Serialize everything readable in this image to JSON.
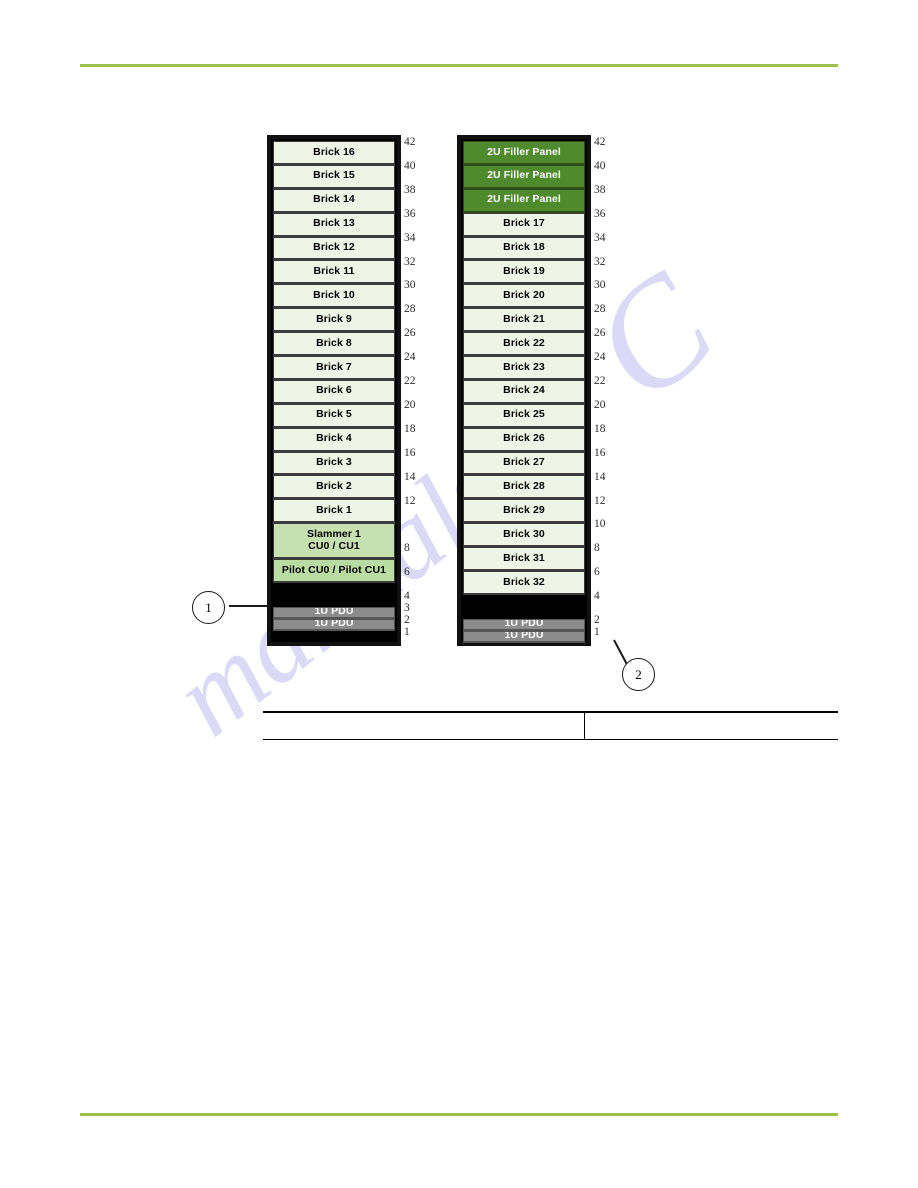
{
  "page": {
    "rule_color": "#9cc14a",
    "watermark_lines": [
      "manualsli",
      "C"
    ]
  },
  "diagram": {
    "racks": [
      {
        "id": "rack-left",
        "name": "left-rack",
        "units": [
          {
            "label": "Brick 16",
            "type": "brick",
            "u": 2
          },
          {
            "label": "Brick 15",
            "type": "brick",
            "u": 2
          },
          {
            "label": "Brick 14",
            "type": "brick",
            "u": 2
          },
          {
            "label": "Brick 13",
            "type": "brick",
            "u": 2
          },
          {
            "label": "Brick 12",
            "type": "brick",
            "u": 2
          },
          {
            "label": "Brick 11",
            "type": "brick",
            "u": 2
          },
          {
            "label": "Brick 10",
            "type": "brick",
            "u": 2
          },
          {
            "label": "Brick 9",
            "type": "brick",
            "u": 2
          },
          {
            "label": "Brick 8",
            "type": "brick",
            "u": 2
          },
          {
            "label": "Brick 7",
            "type": "brick",
            "u": 2
          },
          {
            "label": "Brick 6",
            "type": "brick",
            "u": 2
          },
          {
            "label": "Brick 5",
            "type": "brick",
            "u": 2
          },
          {
            "label": "Brick 4",
            "type": "brick",
            "u": 2
          },
          {
            "label": "Brick 3",
            "type": "brick",
            "u": 2
          },
          {
            "label": "Brick 2",
            "type": "brick",
            "u": 2
          },
          {
            "label": "Brick 1",
            "type": "brick",
            "u": 2
          },
          {
            "label": "Slammer 1\nCU0 / CU1",
            "type": "slammer",
            "u": 3
          },
          {
            "label": "Pilot CU0 / Pilot CU1",
            "type": "pilot",
            "u": 2
          },
          {
            "label": "",
            "type": "blank",
            "u": 2
          },
          {
            "label": "1U PDU",
            "type": "pdu",
            "u": 1
          },
          {
            "label": "1U PDU",
            "type": "pdu",
            "u": 1
          }
        ],
        "ruler": [
          "42",
          "40",
          "38",
          "36",
          "34",
          "32",
          "30",
          "28",
          "26",
          "24",
          "22",
          "20",
          "18",
          "16",
          "14",
          "12",
          "8",
          "6",
          "4",
          "3",
          "2",
          "1"
        ]
      },
      {
        "id": "rack-right",
        "name": "right-rack",
        "units": [
          {
            "label": "2U Filler Panel",
            "type": "filler",
            "u": 2
          },
          {
            "label": "2U Filler Panel",
            "type": "filler",
            "u": 2
          },
          {
            "label": "2U Filler Panel",
            "type": "filler",
            "u": 2
          },
          {
            "label": "Brick 17",
            "type": "brick",
            "u": 2
          },
          {
            "label": "Brick 18",
            "type": "brick",
            "u": 2
          },
          {
            "label": "Brick 19",
            "type": "brick",
            "u": 2
          },
          {
            "label": "Brick 20",
            "type": "brick",
            "u": 2
          },
          {
            "label": "Brick 21",
            "type": "brick",
            "u": 2
          },
          {
            "label": "Brick 22",
            "type": "brick",
            "u": 2
          },
          {
            "label": "Brick 23",
            "type": "brick",
            "u": 2
          },
          {
            "label": "Brick 24",
            "type": "brick",
            "u": 2
          },
          {
            "label": "Brick 25",
            "type": "brick",
            "u": 2
          },
          {
            "label": "Brick 26",
            "type": "brick",
            "u": 2
          },
          {
            "label": "Brick 27",
            "type": "brick",
            "u": 2
          },
          {
            "label": "Brick 28",
            "type": "brick",
            "u": 2
          },
          {
            "label": "Brick 29",
            "type": "brick",
            "u": 2
          },
          {
            "label": "Brick 30",
            "type": "brick",
            "u": 2
          },
          {
            "label": "Brick 31",
            "type": "brick",
            "u": 2
          },
          {
            "label": "Brick 32",
            "type": "brick",
            "u": 2
          },
          {
            "label": "",
            "type": "blank",
            "u": 2
          },
          {
            "label": "1U PDU",
            "type": "pdu",
            "u": 1
          },
          {
            "label": "1U PDU",
            "type": "pdu",
            "u": 1
          }
        ],
        "ruler": [
          "42",
          "40",
          "38",
          "36",
          "34",
          "32",
          "30",
          "28",
          "26",
          "24",
          "22",
          "20",
          "18",
          "16",
          "14",
          "12",
          "10",
          "8",
          "6",
          "4",
          "2",
          "1"
        ]
      }
    ],
    "callouts": [
      {
        "label": "1",
        "name": "callout-marker-1"
      },
      {
        "label": "2",
        "name": "callout-marker-2"
      }
    ],
    "colors": {
      "brick": "#eef4e6",
      "slammer": "#c6e0b0",
      "pilot": "#b9dca2",
      "filler": "#4f8b2c",
      "pdu": "#8c8c8c",
      "blank": "#000000",
      "rack_frame": "#111111"
    }
  },
  "table": {
    "rows": [
      {
        "col_a": "",
        "col_b": ""
      },
      {
        "col_a": "",
        "col_b": ""
      }
    ]
  }
}
